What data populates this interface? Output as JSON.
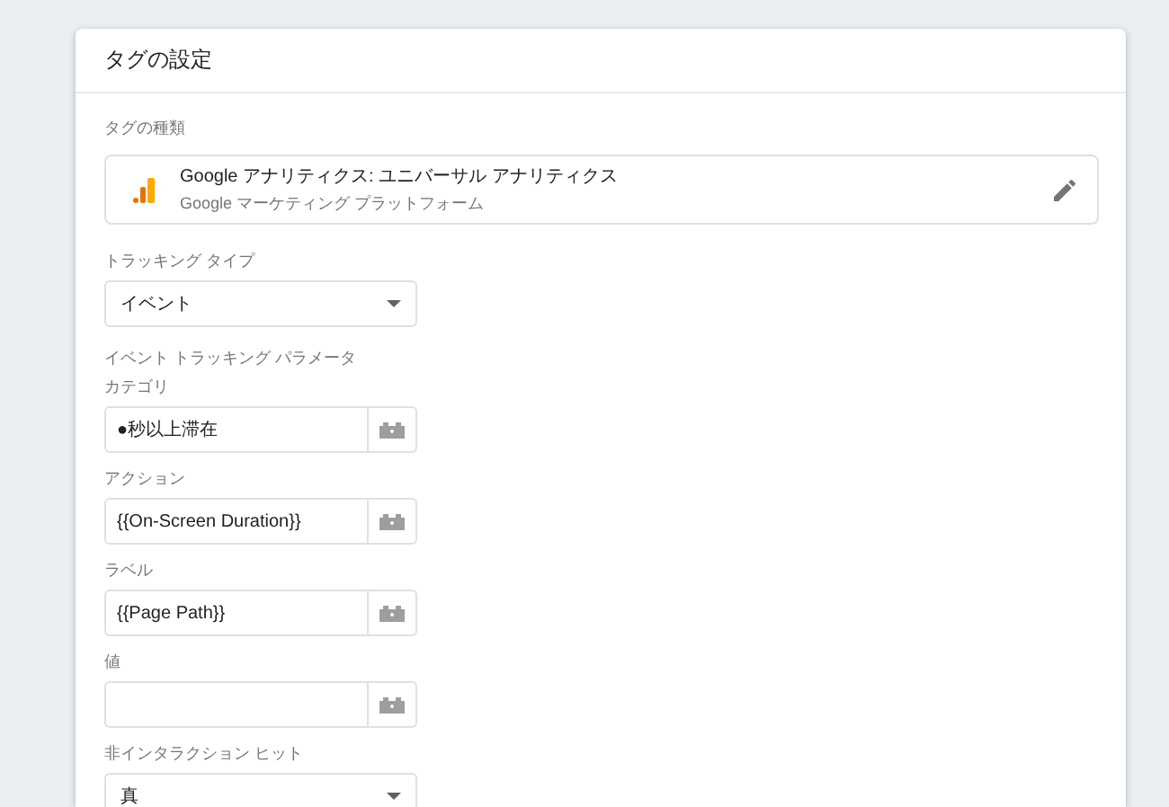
{
  "card": {
    "title": "タグの設定"
  },
  "tag_type": {
    "label": "タグの種類",
    "name": "Google アナリティクス: ユニバーサル アナリティクス",
    "subtitle": "Google マーケティング プラットフォーム"
  },
  "fields": [
    {
      "kind": "select",
      "label": "トラッキング タイプ",
      "value": "イベント"
    },
    {
      "kind": "heading",
      "label": "イベント トラッキング パラメータ"
    },
    {
      "kind": "variable",
      "label": "カテゴリ",
      "value": "●秒以上滞在"
    },
    {
      "kind": "variable",
      "label": "アクション",
      "value": "{{On-Screen Duration}}"
    },
    {
      "kind": "variable",
      "label": "ラベル",
      "value": "{{Page Path}}"
    },
    {
      "kind": "variable",
      "label": "値"
    },
    {
      "kind": "select",
      "label": "非インタラクション ヒット",
      "value": "真"
    }
  ]
}
